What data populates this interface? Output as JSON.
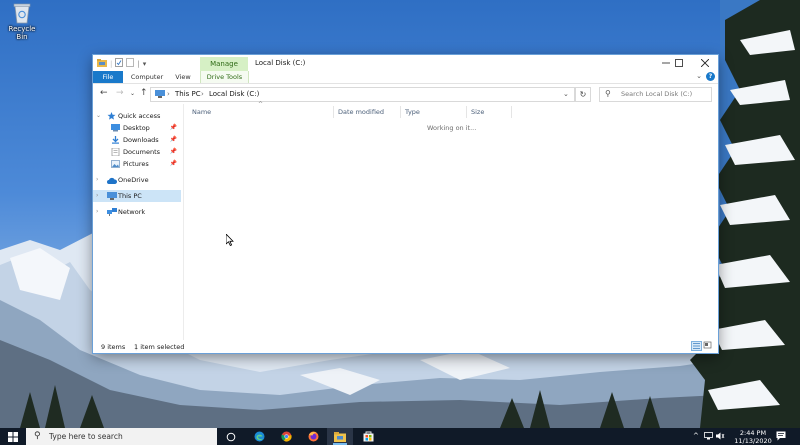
{
  "desktop": {
    "icons": [
      {
        "label": "Recycle Bin",
        "icon": "recycle-bin-icon"
      }
    ]
  },
  "window": {
    "title": "Local Disk (C:)",
    "contextual_tab_group": "Manage",
    "ribbon_tabs": [
      "File",
      "Computer",
      "View",
      "Drive Tools"
    ],
    "address": {
      "breadcrumbs": [
        "This PC",
        "Local Disk (C:)"
      ]
    },
    "search": {
      "placeholder": "Search Local Disk (C:)"
    },
    "nav_pane": {
      "quick_access": {
        "label": "Quick access",
        "icon": "star-icon"
      },
      "pinned": [
        {
          "label": "Desktop",
          "icon": "desktop-folder-icon"
        },
        {
          "label": "Downloads",
          "icon": "download-arrow-icon"
        },
        {
          "label": "Documents",
          "icon": "documents-icon"
        },
        {
          "label": "Pictures",
          "icon": "pictures-icon"
        }
      ],
      "onedrive": {
        "label": "OneDrive",
        "icon": "cloud-icon"
      },
      "this_pc": {
        "label": "This PC",
        "icon": "computer-icon",
        "selected": true
      },
      "network": {
        "label": "Network",
        "icon": "network-icon"
      }
    },
    "columns": [
      "Name",
      "Date modified",
      "Type",
      "Size"
    ],
    "loading_text": "Working on it...",
    "status": {
      "items": "9 items",
      "selected": "1 item selected"
    }
  },
  "taskbar": {
    "search_placeholder": "Type here to search",
    "apps": [
      {
        "icon": "task-view-icon"
      },
      {
        "icon": "edge-icon"
      },
      {
        "icon": "chrome-icon"
      },
      {
        "icon": "firefox-icon"
      },
      {
        "icon": "file-explorer-icon",
        "active": true
      },
      {
        "icon": "store-icon"
      }
    ],
    "clock": {
      "time": "2:44 PM",
      "date": "11/13/2020"
    }
  },
  "colors": {
    "accent": "#1979ca",
    "manage_tab": "#d6f0c5",
    "selection": "#cce4f7",
    "taskbar": "#101a28"
  }
}
